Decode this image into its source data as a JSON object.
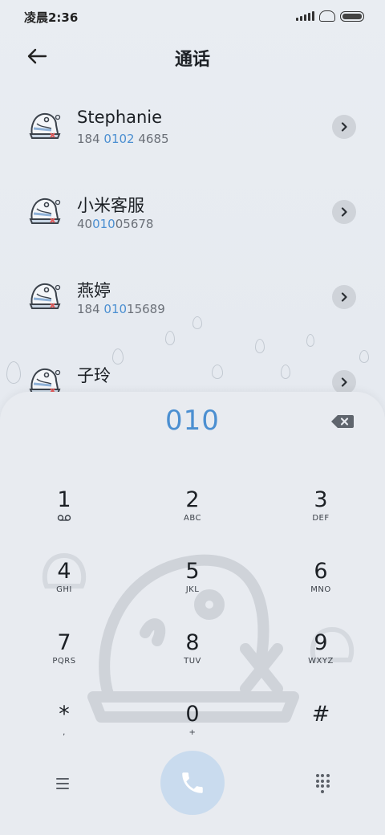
{
  "status_bar": {
    "time": "凌晨2:36"
  },
  "header": {
    "title": "通话",
    "back_icon": "arrow-left-icon"
  },
  "contacts": [
    {
      "name": "Stephanie",
      "number_before": "184 ",
      "number_match": "0102",
      "number_after": " 4685"
    },
    {
      "name": "小米客服",
      "number_before": "40",
      "number_match": "010",
      "number_after": "05678"
    },
    {
      "name": "燕婷",
      "number_before": "184 ",
      "number_match": "010",
      "number_after": "15689"
    },
    {
      "name": "子玲",
      "number_before": "",
      "number_match": "",
      "number_after": ""
    }
  ],
  "dialer": {
    "input": "010",
    "keys": [
      {
        "digit": "1",
        "letters": ""
      },
      {
        "digit": "2",
        "letters": "ABC"
      },
      {
        "digit": "3",
        "letters": "DEF"
      },
      {
        "digit": "4",
        "letters": "GHI"
      },
      {
        "digit": "5",
        "letters": "JKL"
      },
      {
        "digit": "6",
        "letters": "MNO"
      },
      {
        "digit": "7",
        "letters": "PQRS"
      },
      {
        "digit": "8",
        "letters": "TUV"
      },
      {
        "digit": "9",
        "letters": "WXYZ"
      },
      {
        "digit": "*",
        "letters": ","
      },
      {
        "digit": "0",
        "letters": "+"
      },
      {
        "digit": "#",
        "letters": ""
      }
    ]
  },
  "colors": {
    "accent": "#4b8fd1",
    "call_button": "#c9dbee"
  }
}
